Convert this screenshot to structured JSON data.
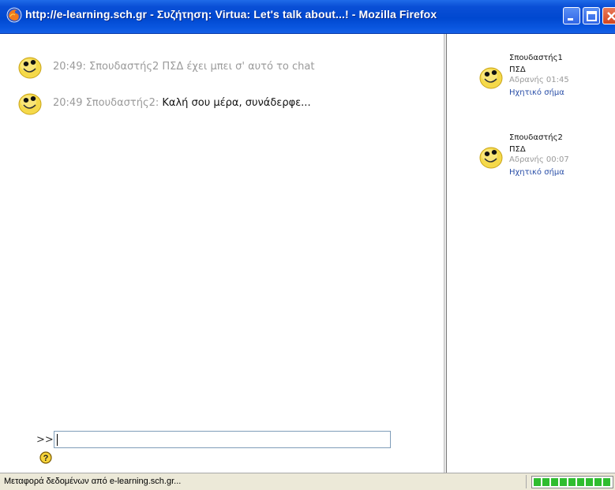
{
  "window": {
    "title": "http://e-learning.sch.gr - Συζήτηση: Virtua: Let's talk about...! - Mozilla Firefox",
    "icons": {
      "app": "firefox-icon",
      "minimize": "minimize-icon",
      "maximize": "maximize-icon",
      "close": "close-icon"
    }
  },
  "chat": {
    "messages": [
      {
        "meta": "20:49: Σπουδαστής2 ΠΣΔ έχει μπει σ' αυτό το chat",
        "content": "",
        "icon": "smiley-icon"
      },
      {
        "meta": "20:49 Σπουδαστής2: ",
        "content": "Καλή σου μέρα, συνάδερφε...",
        "icon": "smiley-icon"
      }
    ],
    "input": {
      "prompt": ">>",
      "value": "",
      "help_icon": "help-icon"
    }
  },
  "users": [
    {
      "name_line1": "Σπουδαστής1",
      "name_line2": "ΠΣΔ",
      "idle": "Αδρανής 01:45",
      "beep": "Ηχητικό σήμα"
    },
    {
      "name_line1": "Σπουδαστής2",
      "name_line2": "ΠΣΔ",
      "idle": "Αδρανής 00:07",
      "beep": "Ηχητικό σήμα"
    }
  ],
  "status": {
    "text": "Μεταφορά δεδομένων από e-learning.sch.gr...",
    "progress": 1.0
  },
  "colors": {
    "titlebar": "#0048d0",
    "link": "#2a4fa8",
    "muted": "#9a9a9a",
    "progress": "#2fbd2f"
  }
}
